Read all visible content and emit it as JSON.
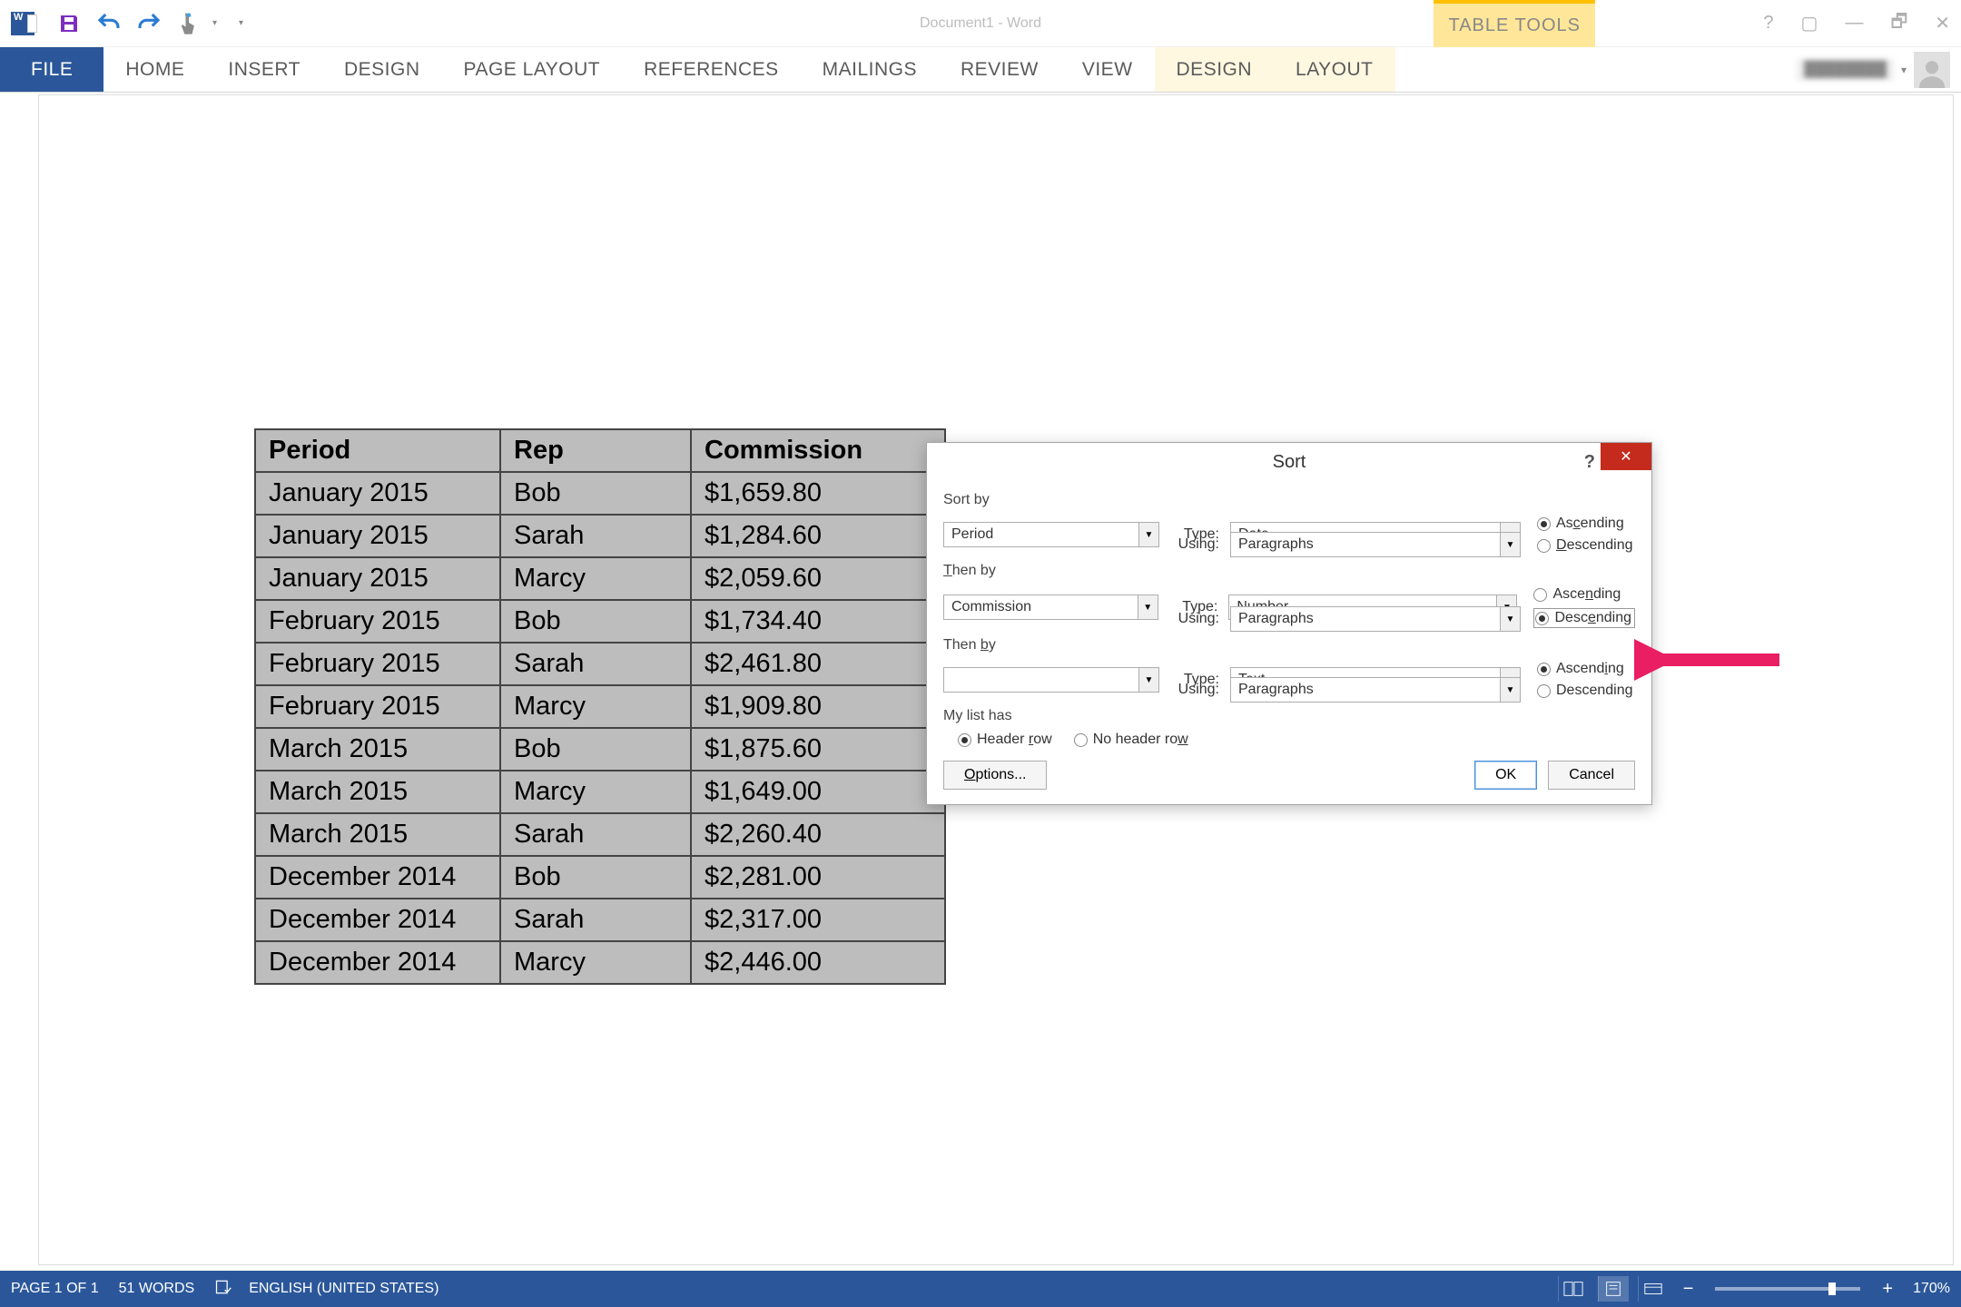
{
  "title": "Document1 - Word",
  "contextual_tab": "TABLE TOOLS",
  "ribbon": {
    "file": "FILE",
    "tabs": [
      "HOME",
      "INSERT",
      "DESIGN",
      "PAGE LAYOUT",
      "REFERENCES",
      "MAILINGS",
      "REVIEW",
      "VIEW"
    ],
    "context_tabs": [
      "DESIGN",
      "LAYOUT"
    ]
  },
  "table": {
    "headers": [
      "Period",
      "Rep",
      "Commission"
    ],
    "rows": [
      [
        "January 2015",
        "Bob",
        "$1,659.80"
      ],
      [
        "January 2015",
        "Sarah",
        "$1,284.60"
      ],
      [
        "January 2015",
        "Marcy",
        "$2,059.60"
      ],
      [
        "February 2015",
        "Bob",
        "$1,734.40"
      ],
      [
        "February 2015",
        "Sarah",
        "$2,461.80"
      ],
      [
        "February 2015",
        "Marcy",
        "$1,909.80"
      ],
      [
        "March 2015",
        "Bob",
        "$1,875.60"
      ],
      [
        "March 2015",
        "Marcy",
        "$1,649.00"
      ],
      [
        "March 2015",
        "Sarah",
        "$2,260.40"
      ],
      [
        "December 2014",
        "Bob",
        "$2,281.00"
      ],
      [
        "December 2014",
        "Sarah",
        "$2,317.00"
      ],
      [
        "December 2014",
        "Marcy",
        "$2,446.00"
      ]
    ]
  },
  "dialog": {
    "title": "Sort",
    "help": "?",
    "close": "✕",
    "labels": {
      "sort_by": "Sort by",
      "then_by": "Then by",
      "then_by2": "Then by",
      "type": "Type:",
      "using": "Using:",
      "my_list_has": "My list has",
      "header_row": "Header row",
      "no_header_row": "No header row",
      "ascending": "Ascending",
      "descending": "Descending",
      "options": "Options...",
      "ok": "OK",
      "cancel": "Cancel"
    },
    "sort1": {
      "field": "Period",
      "type": "Date",
      "using": "Paragraphs",
      "order": "asc"
    },
    "sort2": {
      "field": "Commission",
      "type": "Number",
      "using": "Paragraphs",
      "order": "desc"
    },
    "sort3": {
      "field": "",
      "type": "Text",
      "using": "Paragraphs",
      "order": "asc"
    },
    "header_row_selected": true
  },
  "status": {
    "page": "PAGE 1 OF 1",
    "words": "51 WORDS",
    "language": "ENGLISH (UNITED STATES)",
    "zoom": "170%"
  }
}
